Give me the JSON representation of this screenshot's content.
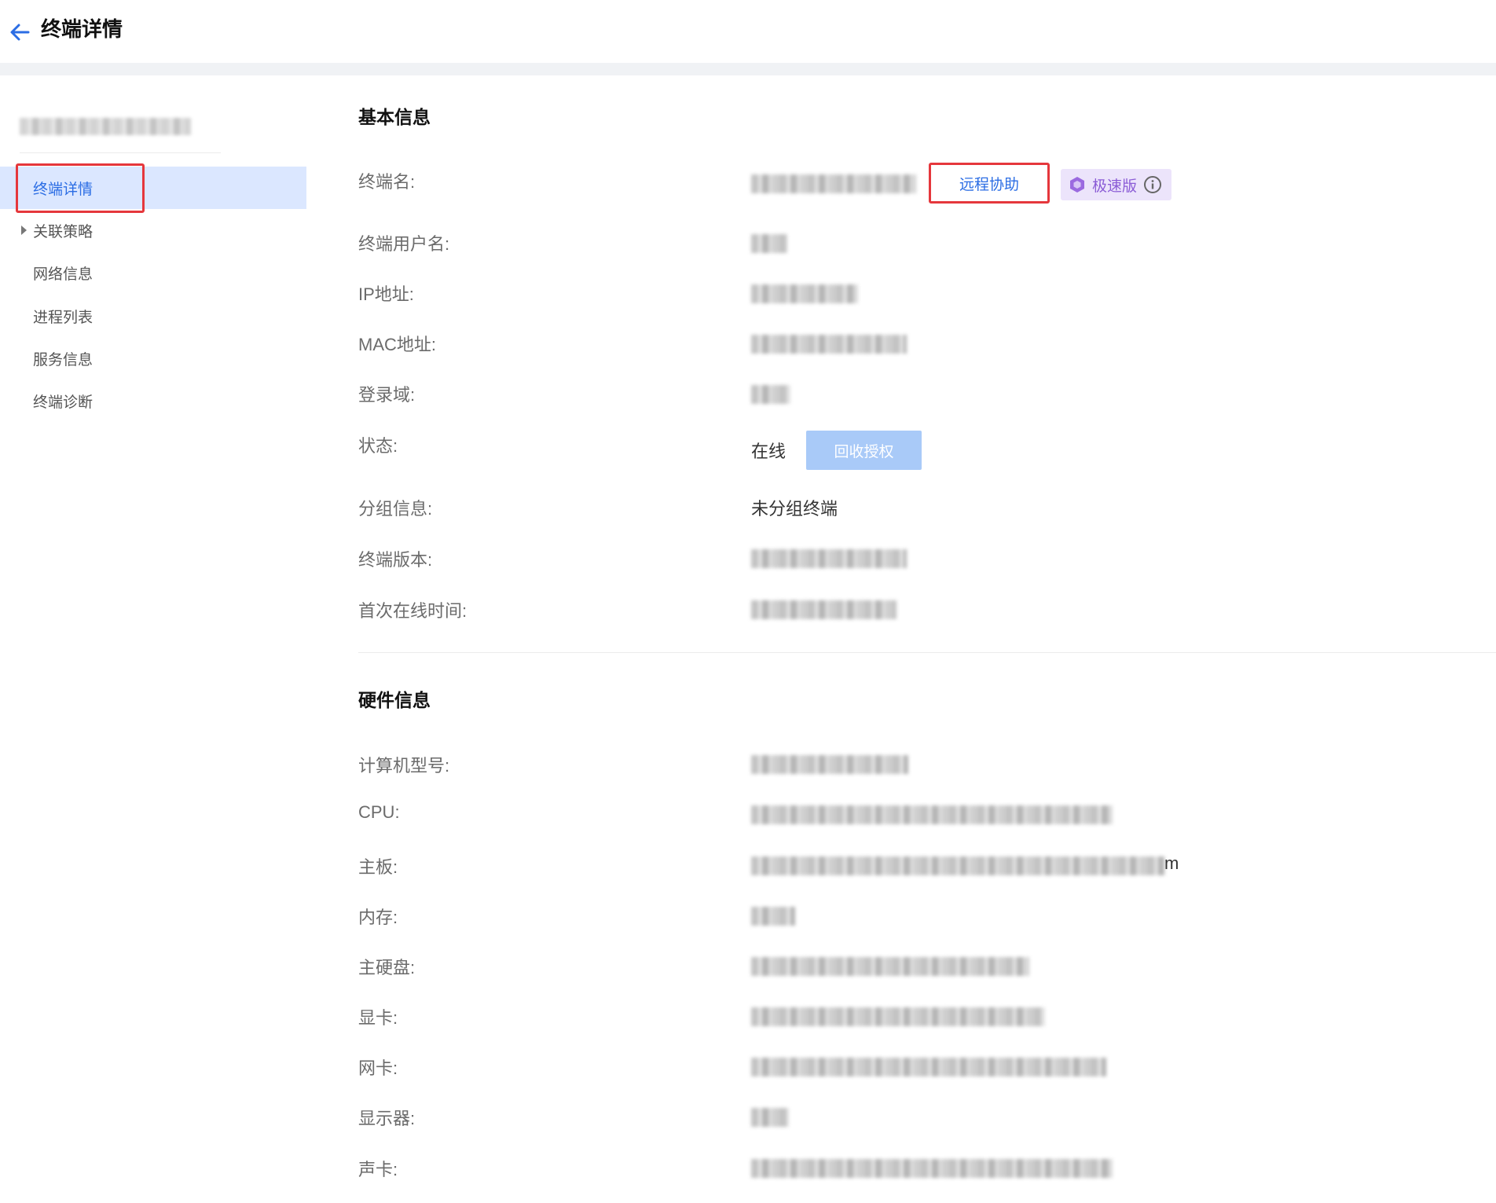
{
  "header": {
    "title": "终端详情"
  },
  "sidebar": {
    "items": [
      {
        "label": "终端详情"
      },
      {
        "label": "关联策略"
      },
      {
        "label": "网络信息"
      },
      {
        "label": "进程列表"
      },
      {
        "label": "服务信息"
      },
      {
        "label": "终端诊断"
      }
    ]
  },
  "basic": {
    "title": "基本信息",
    "labels": {
      "name": "终端名:",
      "username": "终端用户名:",
      "ip": "IP地址:",
      "mac": "MAC地址:",
      "domain": "登录域:",
      "status": "状态:",
      "group": "分组信息:",
      "version": "终端版本:",
      "first_online": "首次在线时间:"
    },
    "status_value": "在线",
    "group_value": "未分组终端",
    "remote_button": "远程协助",
    "fast_badge": "极速版",
    "revoke_button": "回收授权"
  },
  "hardware": {
    "title": "硬件信息",
    "labels": {
      "model": "计算机型号:",
      "cpu": "CPU:",
      "board": "主板:",
      "memory": "内存:",
      "disk": "主硬盘:",
      "gpu": "显卡:",
      "nic": "网卡:",
      "monitor": "显示器:",
      "sound": "声卡:"
    },
    "board_tail": "m"
  },
  "colors": {
    "accent": "#2b6de4",
    "highlight": "#e5373c",
    "active_bg": "#dbe7ff",
    "badge_bg": "#ece4fb",
    "badge_fg": "#8b5cd6"
  }
}
